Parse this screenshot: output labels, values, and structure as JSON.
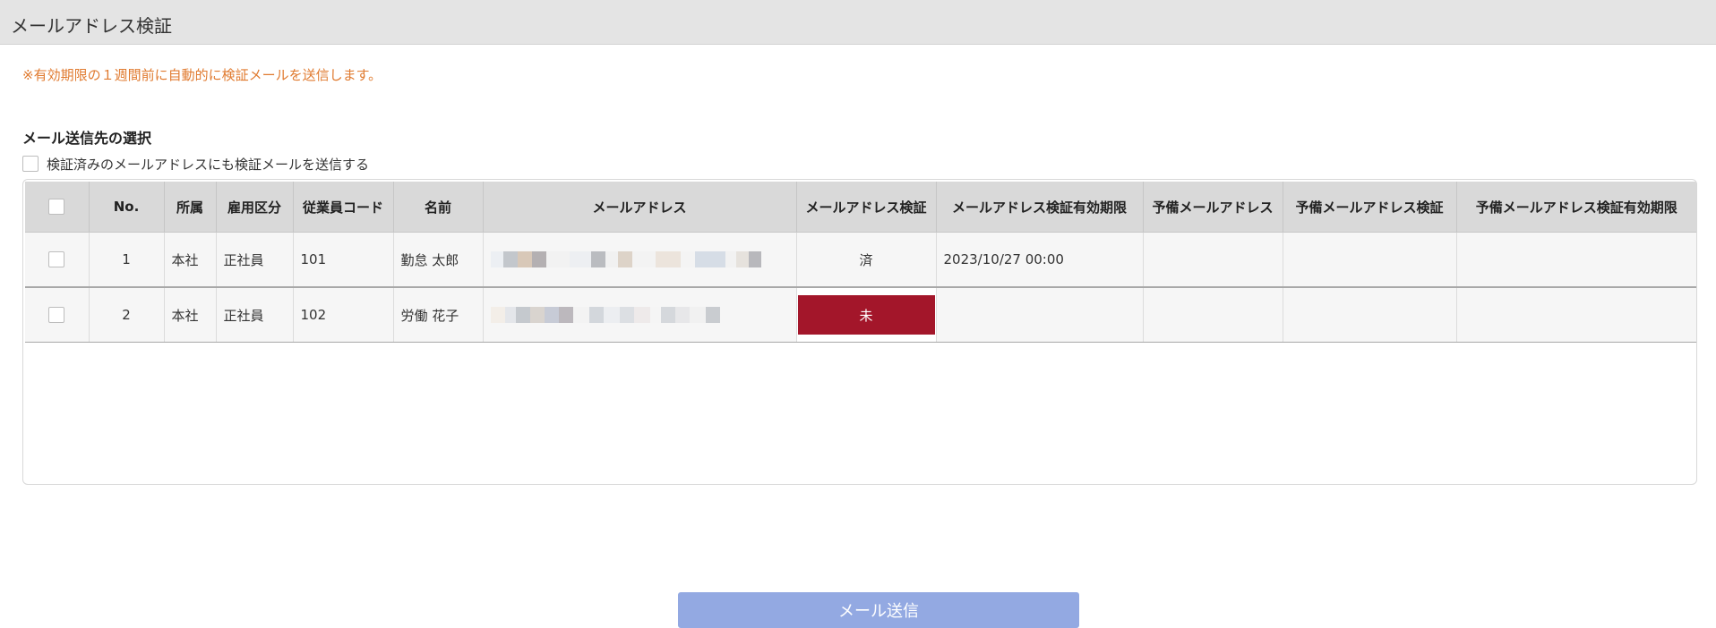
{
  "page": {
    "title": "メールアドレス検証"
  },
  "notice": "※有効期限の１週間前に自動的に検証メールを送信します。",
  "recipient": {
    "section_title": "メール送信先の選択",
    "include_verified_label": "検証済みのメールアドレスにも検証メールを送信する"
  },
  "table": {
    "headers": {
      "no": "No.",
      "dept": "所属",
      "employment": "雇用区分",
      "code": "従業員コード",
      "name": "名前",
      "email": "メールアドレス",
      "verified": "メールアドレス検証",
      "expiry": "メールアドレス検証有効期限",
      "spare_email": "予備メールアドレス",
      "spare_verified": "予備メールアドレス検証",
      "spare_expiry": "予備メールアドレス検証有効期限"
    },
    "rows": [
      {
        "no": "1",
        "dept": "本社",
        "employment": "正社員",
        "code": "101",
        "name": "勤怠 太郎",
        "verified": "済",
        "expiry": "2023/10/27 00:00"
      },
      {
        "no": "2",
        "dept": "本社",
        "employment": "正社員",
        "code": "102",
        "name": "労働 花子",
        "verified": "未",
        "expiry": ""
      }
    ]
  },
  "send_button": "メール送信",
  "colors": {
    "notice": "#e07a2f",
    "unverified_bg": "#a3162a",
    "highlight_border": "#e8101a",
    "send_button_bg": "#93a9e2"
  }
}
